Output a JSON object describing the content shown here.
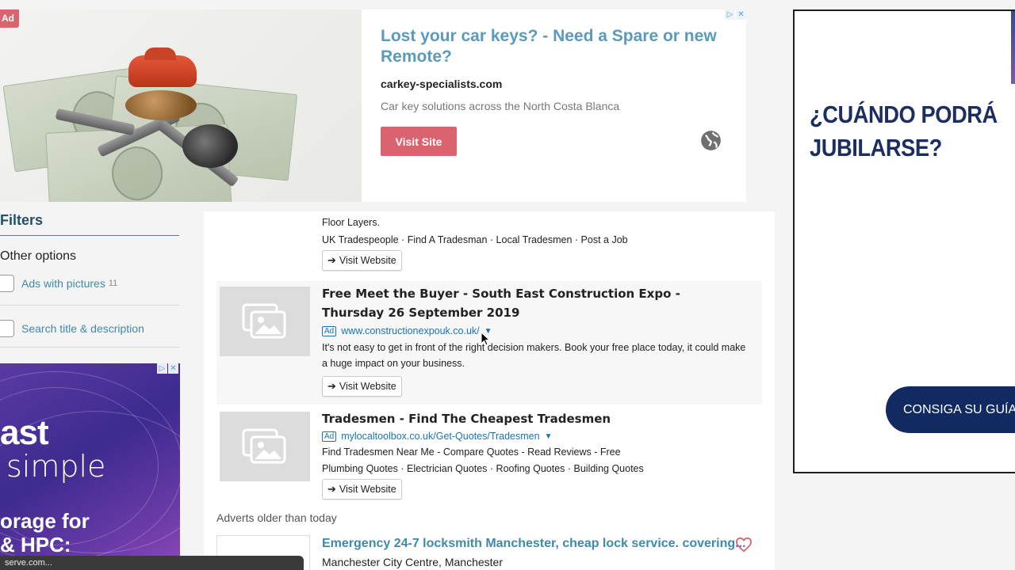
{
  "top_ad": {
    "badge": "Ad",
    "headline": "Lost your car keys? - Need a Spare or new Remote?",
    "domain": "carkey-specialists.com",
    "description": "Car key solutions across the North Costa Blanca",
    "cta_label": "Visit Site",
    "icons": [
      "adchoices-icon",
      "close-icon",
      "globe-icon"
    ]
  },
  "filters": {
    "title": "Filters",
    "subtitle": "Other options",
    "options": [
      {
        "label": "Ads with pictures",
        "count": "11",
        "checked": false
      },
      {
        "label": "Search title & description",
        "count": "",
        "checked": false
      }
    ]
  },
  "left_ad": {
    "line1": "ast",
    "line2": "simple",
    "line3a": "orage for",
    "line3b": "& HPC:"
  },
  "results": {
    "top_item": {
      "trailing_text": "Floor Layers.",
      "links": "UK Tradespeople · Find A Tradesman · Local Tradesmen · Post a Job",
      "visit_label": "Visit Website"
    },
    "ads": [
      {
        "title": "Free Meet the Buyer - South East Construction Expo - Thursday 26 September 2019",
        "tag": "Ad",
        "url": "www.constructionexpouk.co.uk/",
        "description": "It's not easy to get in front of the right decision makers. Book your free place today, it could make a huge impact on your business.",
        "visit_label": "Visit Website"
      },
      {
        "title": "Tradesmen - Find The Cheapest Tradesmen",
        "tag": "Ad",
        "url": "mylocaltoolbox.co.uk/Get-Quotes/Tradesmen",
        "description_line1": "Find Tradesmen Near Me - Compare Quotes - Read Reviews - Free",
        "description_line2": "Plumbing Quotes · Electrician Quotes · Roofing Quotes · Building Quotes",
        "visit_label": "Visit Website"
      }
    ],
    "older_header": "Adverts older than today",
    "older_items": [
      {
        "title": "Emergency 24-7 locksmith Manchester, cheap lock service. covering...",
        "location": "Manchester City Centre, Manchester"
      }
    ]
  },
  "right_ad": {
    "headline_line1": "¿CUÁNDO PODRÁ",
    "headline_line2": "JUBILARSE?",
    "cta_label": "CONSIGA SU GUÍA",
    "cta_icon": "chevron-right-icon"
  },
  "statusbar": {
    "text": "serve.com..."
  },
  "colors": {
    "accent_red": "#d9646f",
    "link_blue": "#3f8aa8",
    "ad_url_blue": "#1a73b6",
    "navy": "#122a62"
  }
}
